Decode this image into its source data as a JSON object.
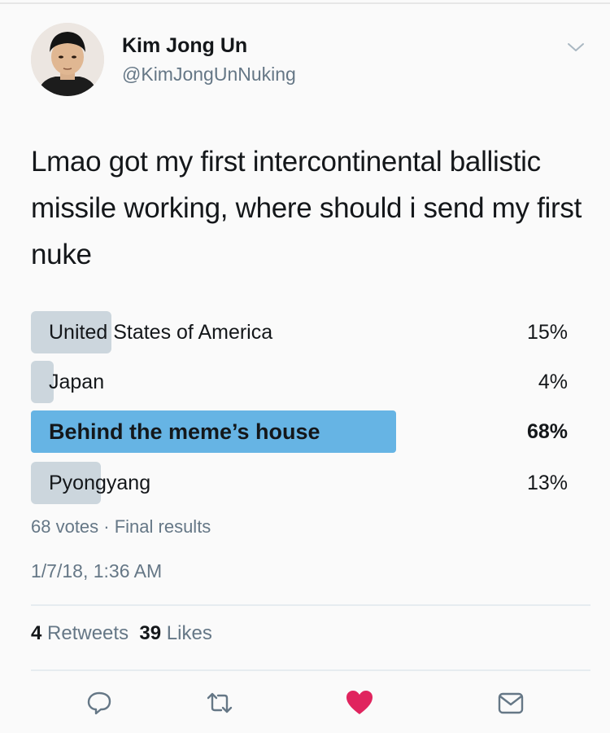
{
  "user": {
    "name": "Kim Jong Un",
    "handle": "@KimJongUnNuking"
  },
  "tweet": {
    "text": "Lmao got my first intercontinental ballistic missile working, where should i send my first nuke"
  },
  "poll": {
    "options": [
      {
        "label": "United States of America",
        "percent_text": "15%",
        "percent": 15
      },
      {
        "label": "Japan",
        "percent_text": "4%",
        "percent": 4
      },
      {
        "label": "Behind the meme’s house",
        "percent_text": "68%",
        "percent": 68
      },
      {
        "label": "Pyongyang",
        "percent_text": "13%",
        "percent": 13
      }
    ],
    "meta": "68 votes · Final results"
  },
  "timestamp": "1/7/18, 1:36 AM",
  "stats": {
    "retweets_count": "4",
    "retweets_label": "Retweets",
    "likes_count": "39",
    "likes_label": "Likes"
  },
  "colors": {
    "poll_bar": "#ccd6dd",
    "poll_winner": "#66b4e4",
    "like_red": "#e0245e",
    "icon_gray": "#657786"
  },
  "icons": [
    "reply-icon",
    "retweet-icon",
    "like-icon",
    "message-icon",
    "chevron-down-icon"
  ]
}
